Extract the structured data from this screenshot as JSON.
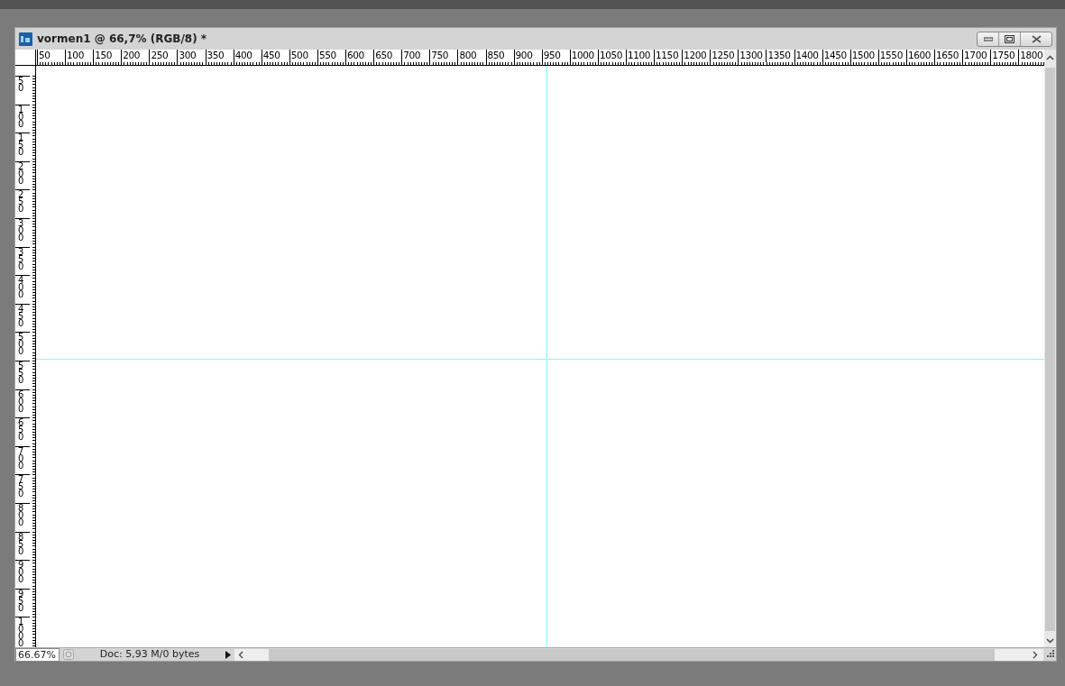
{
  "window": {
    "title": "vormen1 @ 66,7% (RGB/8) *"
  },
  "ruler_top": {
    "labels": [
      "50",
      "100",
      "150",
      "200",
      "250",
      "300",
      "350",
      "400",
      "450",
      "500",
      "550",
      "600",
      "650",
      "700",
      "750",
      "800",
      "850",
      "900",
      "950",
      "1000",
      "1050",
      "1100",
      "1150",
      "1200",
      "1250",
      "1300",
      "1350",
      "1400",
      "1450",
      "1500",
      "1550",
      "1600",
      "1650",
      "1700",
      "1750",
      "1800"
    ]
  },
  "ruler_left": {
    "labels": [
      "50",
      "100",
      "150",
      "200",
      "250",
      "300",
      "350",
      "400",
      "450",
      "500",
      "550",
      "600",
      "650",
      "700",
      "750",
      "800",
      "850",
      "900",
      "950",
      "1000"
    ]
  },
  "status_bar": {
    "zoom": "66.67%",
    "doc_info": "Doc: 5,93 M/0 bytes"
  }
}
